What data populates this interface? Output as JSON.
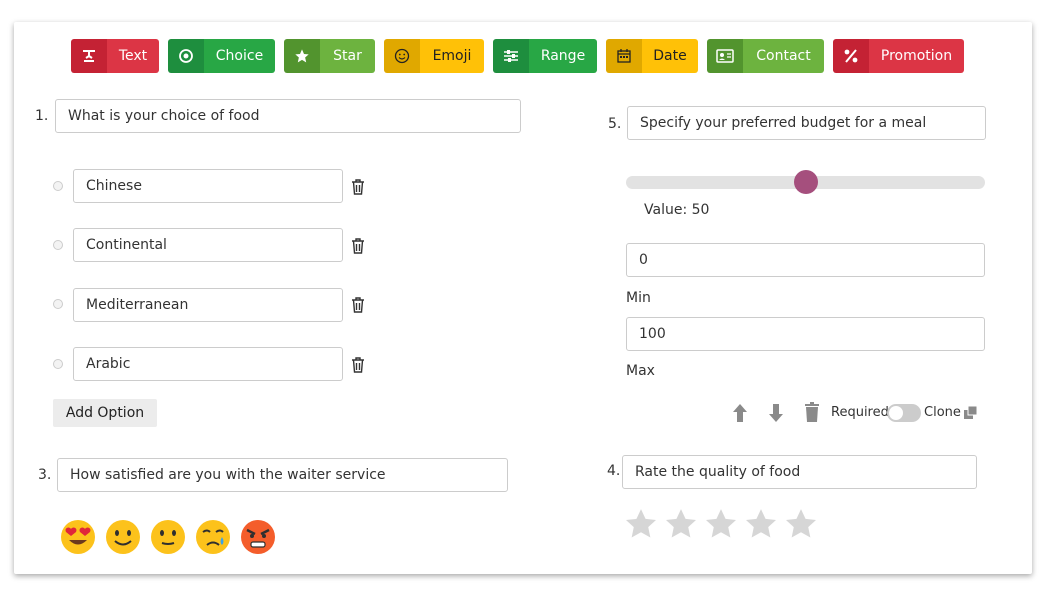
{
  "toolbar": {
    "buttons": [
      {
        "label": "Text",
        "icon": "text-format-icon",
        "icon_bg": "#c42234",
        "label_bg": "#dc3545"
      },
      {
        "label": "Choice",
        "icon": "radio-target-icon",
        "icon_bg": "#1e8e3e",
        "label_bg": "#28a745"
      },
      {
        "label": "Star",
        "icon": "star-icon",
        "icon_bg": "#52942e",
        "label_bg": "#6db33f"
      },
      {
        "label": "Emoji",
        "icon": "smiley-icon",
        "icon_bg": "#e0a800",
        "label_bg": "#ffc107"
      },
      {
        "label": "Range",
        "icon": "sliders-icon",
        "icon_bg": "#1e8e3e",
        "label_bg": "#28a745"
      },
      {
        "label": "Date",
        "icon": "calendar-icon",
        "icon_bg": "#e0a800",
        "label_bg": "#ffc107"
      },
      {
        "label": "Contact",
        "icon": "contact-card-icon",
        "icon_bg": "#52942e",
        "label_bg": "#6db33f"
      },
      {
        "label": "Promotion",
        "icon": "percent-icon",
        "icon_bg": "#c42234",
        "label_bg": "#dc3545"
      }
    ]
  },
  "q1": {
    "number": "1.",
    "question": "What is your choice of food",
    "options": [
      "Chinese",
      "Continental",
      "Mediterranean",
      "Arabic"
    ],
    "add_option_label": "Add Option"
  },
  "q3": {
    "number": "3.",
    "question": "How satisfied are you with the waiter service",
    "emojis": [
      "heart-eyes",
      "smiling",
      "neutral",
      "crying",
      "angry"
    ]
  },
  "q5": {
    "number": "5.",
    "question": "Specify your preferred budget for a meal",
    "slider_value": 50,
    "value_label": "Value:  50",
    "min_value": "0",
    "min_label": "Min",
    "max_value": "100",
    "max_label": "Max",
    "required_label": "Required",
    "clone_label": "Clone",
    "required_on": false
  },
  "q4": {
    "number": "4.",
    "question": "Rate the quality of food",
    "stars_total": 5,
    "stars_filled": 0
  },
  "colors": {
    "slider_thumb": "#a54f7d",
    "star_empty": "#d6d6d6"
  }
}
